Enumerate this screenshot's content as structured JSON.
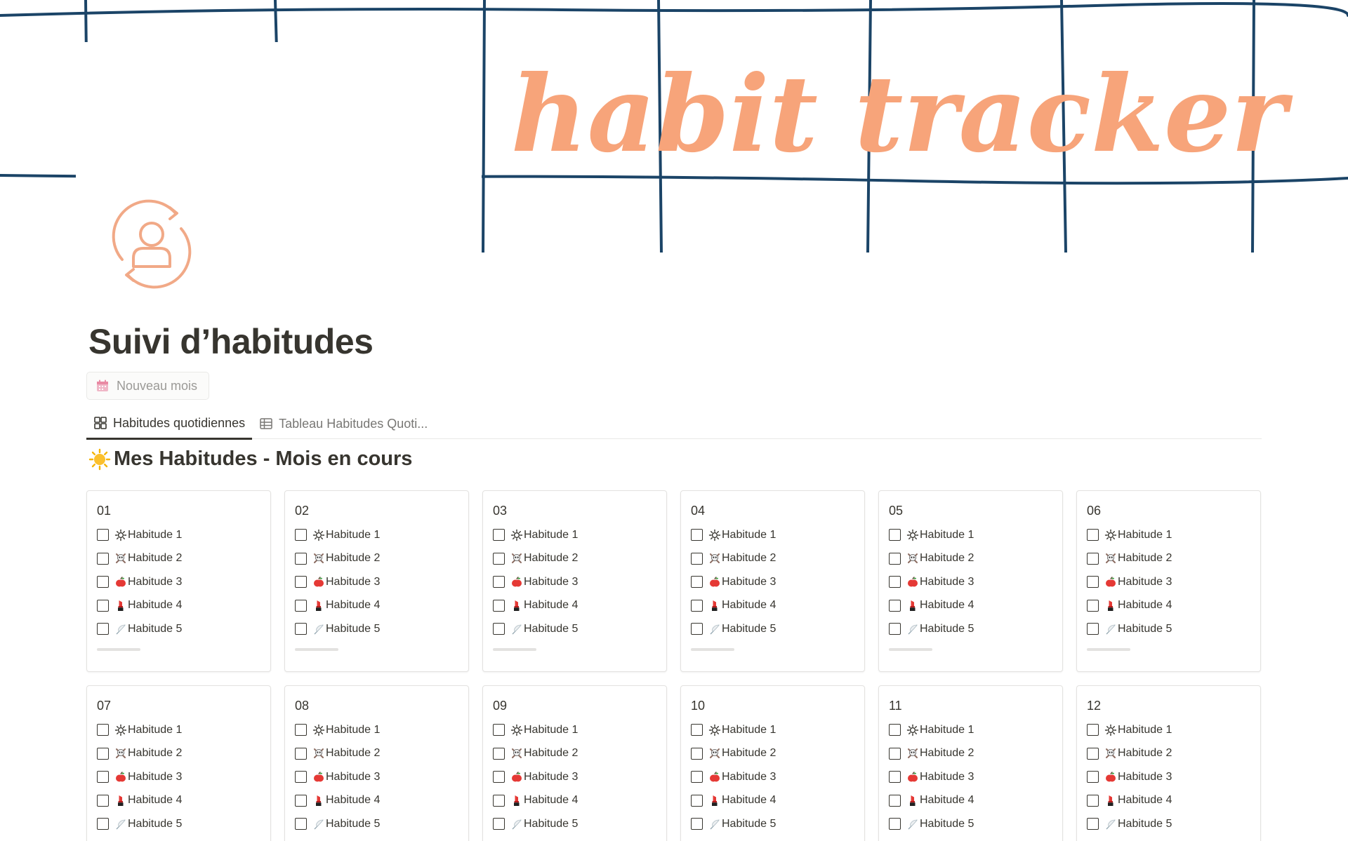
{
  "cover": {
    "title_art": "habit tracker",
    "grid_color": "#1b4467",
    "title_color": "#f7a47a"
  },
  "page_icon": {
    "name": "user-sync-icon",
    "color": "#f1a987"
  },
  "page_title": "Suivi d’habitudes",
  "new_month_button": {
    "label": "Nouveau mois",
    "icon": "calendar-icon"
  },
  "tabs": [
    {
      "label": "Habitudes quotidiennes",
      "icon": "gallery-icon",
      "active": true
    },
    {
      "label": "Tableau Habitudes Quoti...",
      "icon": "table-icon",
      "active": false
    }
  ],
  "section": {
    "emoji": "sun-emoji",
    "title": "Mes Habitudes - Mois en cours"
  },
  "habit_labels": [
    "Habitude 1",
    "Habitude 2",
    "Habitude 3",
    "Habitude 4",
    "Habitude 5"
  ],
  "habit_icons": [
    "sun-icon",
    "skull-crossbones-icon",
    "apple-icon",
    "lipstick-icon",
    "feather-icon"
  ],
  "cards": [
    {
      "day": "01",
      "progress": 0
    },
    {
      "day": "02",
      "progress": 0
    },
    {
      "day": "03",
      "progress": 0
    },
    {
      "day": "04",
      "progress": 0
    },
    {
      "day": "05",
      "progress": 0
    },
    {
      "day": "06",
      "progress": 0
    },
    {
      "day": "07",
      "progress": 0
    },
    {
      "day": "08",
      "progress": 0
    },
    {
      "day": "09",
      "progress": 0
    },
    {
      "day": "10",
      "progress": 0
    },
    {
      "day": "11",
      "progress": 0
    },
    {
      "day": "12",
      "progress": 0
    }
  ]
}
